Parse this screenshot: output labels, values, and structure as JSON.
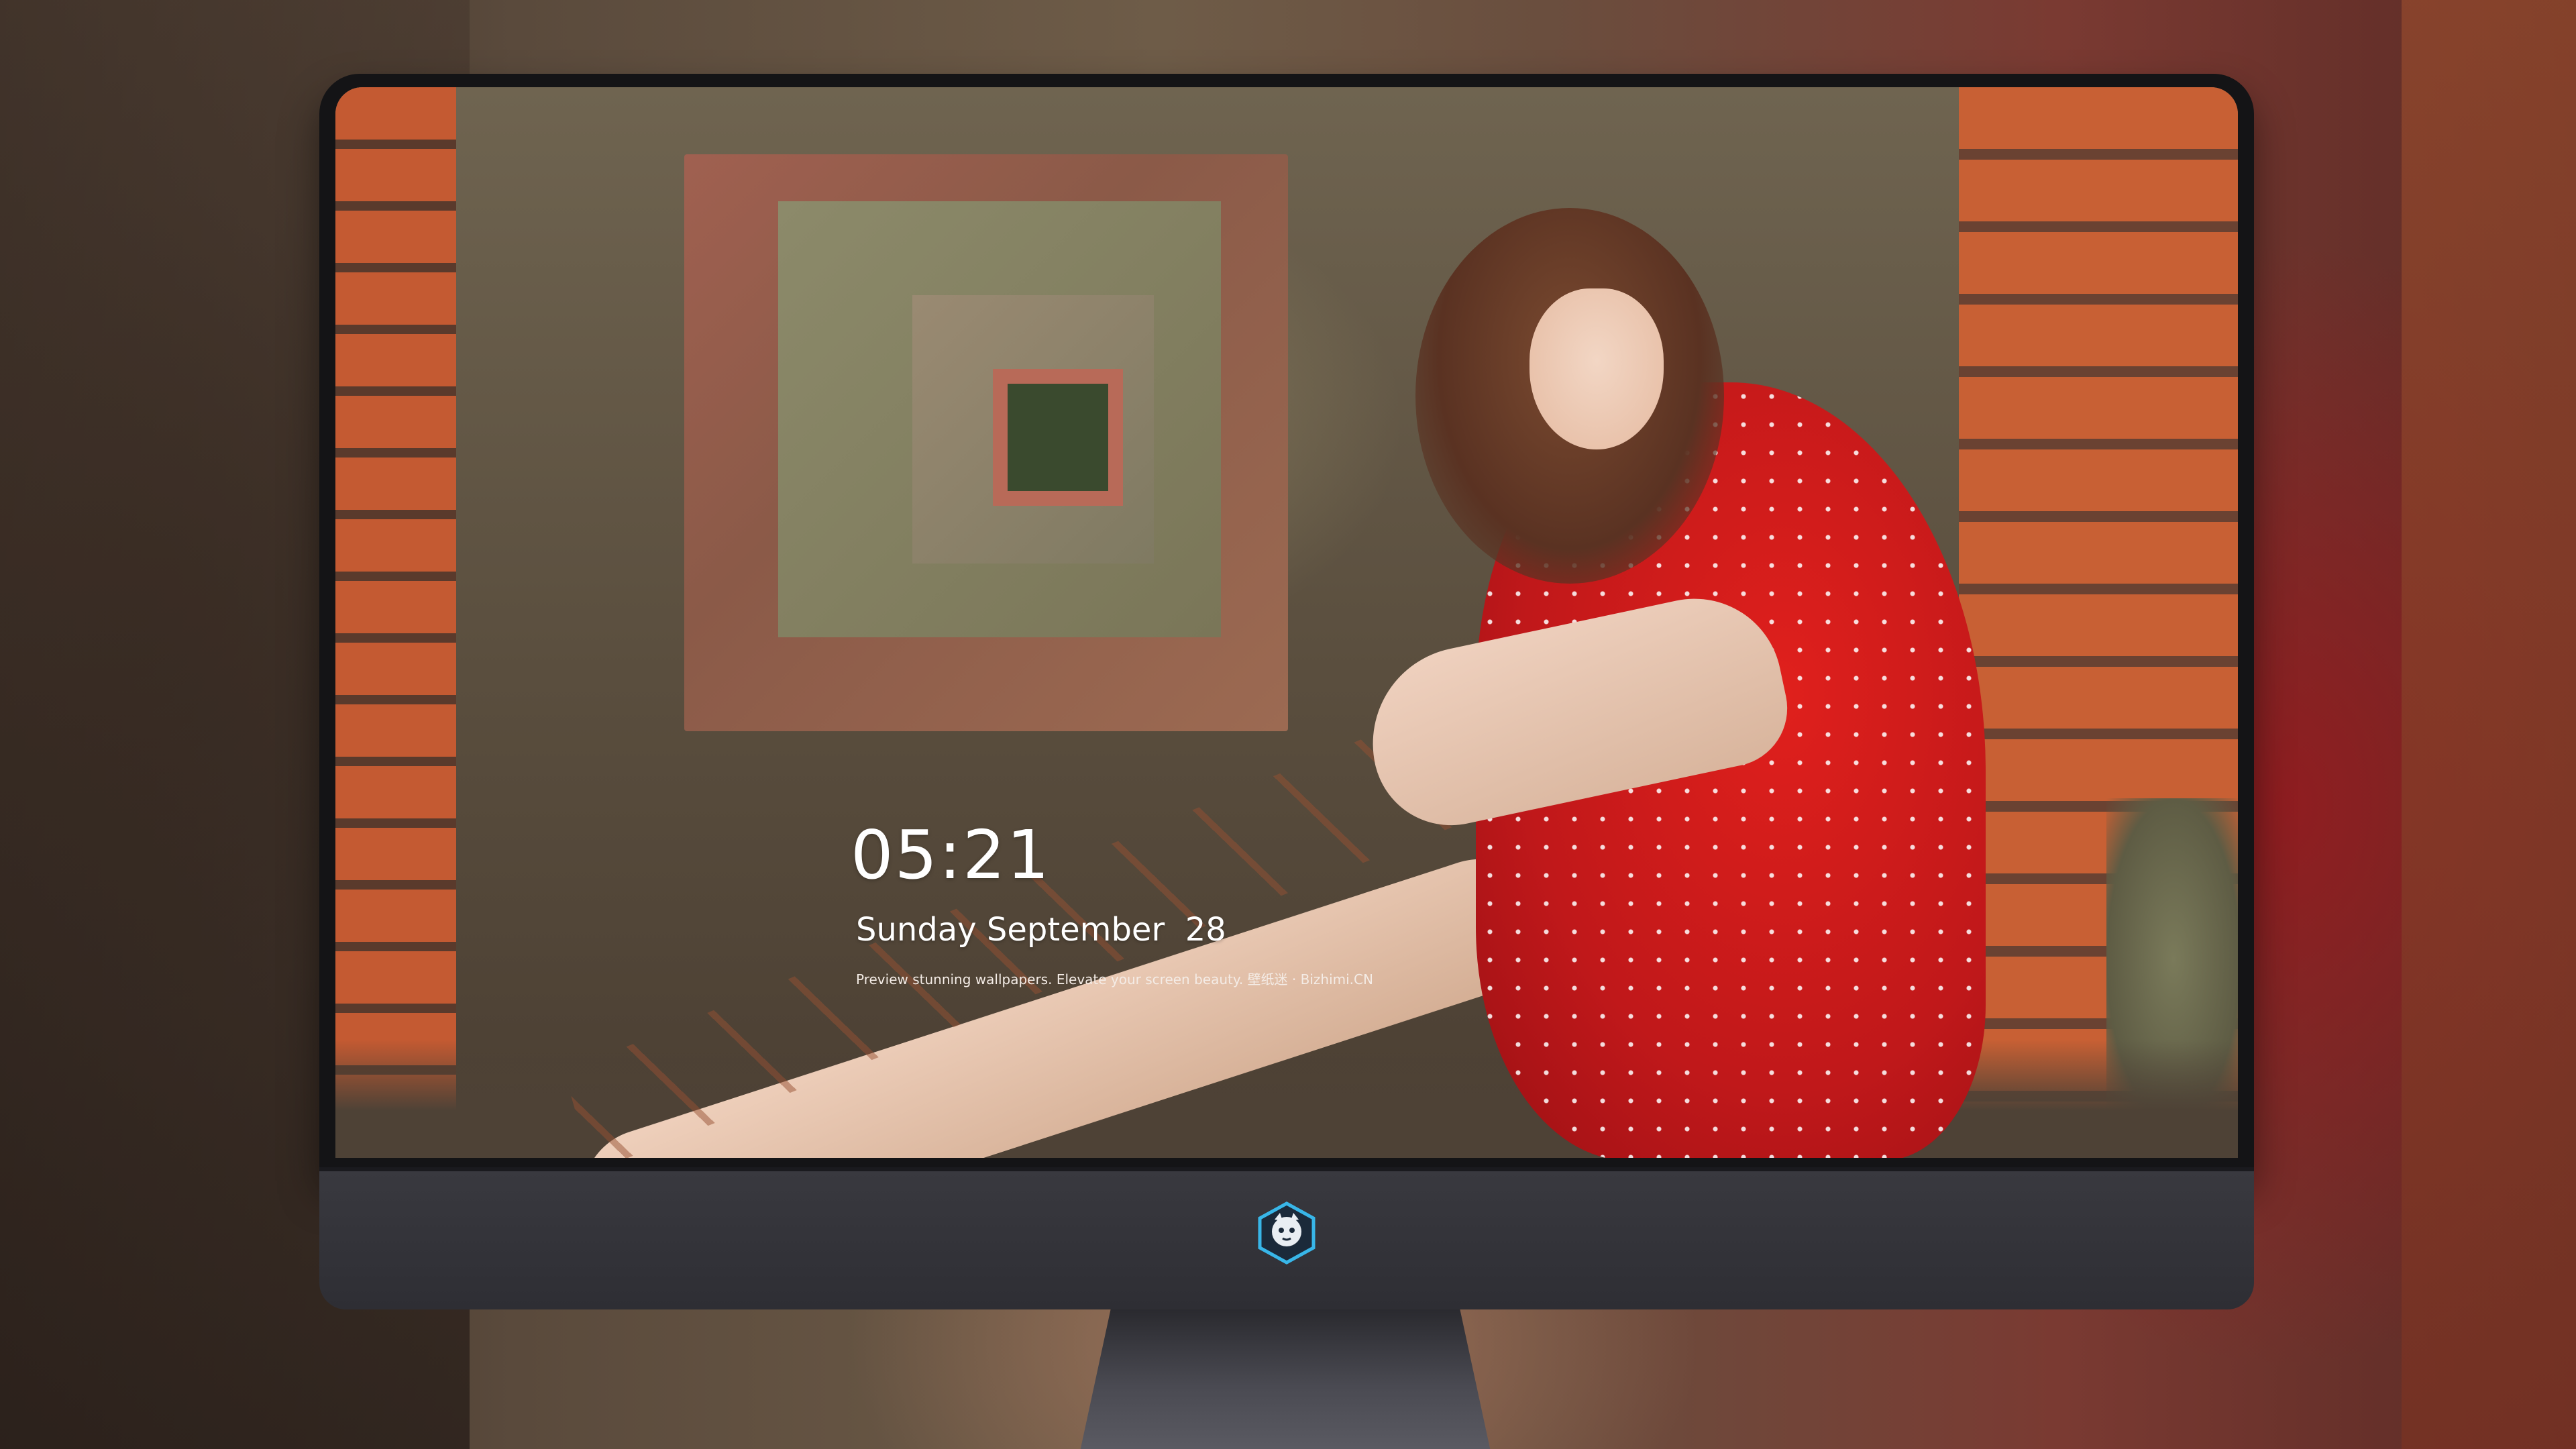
{
  "lockscreen": {
    "time": "05:21",
    "date": "Sunday September  28",
    "tagline": "Preview stunning wallpapers. Elevate your screen beauty. 壁纸迷 · Bizhimi.CN"
  },
  "dock": {
    "apps": [
      {
        "name": "messages-icon",
        "color": "#30c94a"
      },
      {
        "name": "weather-icon",
        "color": "#3a8ee8"
      },
      {
        "name": "clock-icon",
        "color": "#ffffff"
      },
      {
        "name": "preview-icon",
        "color": "#e8b93a"
      },
      {
        "name": "clips-icon",
        "color": "#38b0d8"
      },
      {
        "name": "notes-icon",
        "color": "#f5d54a"
      },
      {
        "name": "photo-booth-icon",
        "color": "#4aa84e"
      },
      {
        "name": "music-icon",
        "color": "#e03a9a"
      },
      {
        "name": "app-store-icon",
        "color": "#2a8cf0"
      },
      {
        "name": "screenshot-icon",
        "color": "#6b6b70"
      }
    ]
  },
  "monitor": {
    "logo": "bizhimi-logo"
  }
}
